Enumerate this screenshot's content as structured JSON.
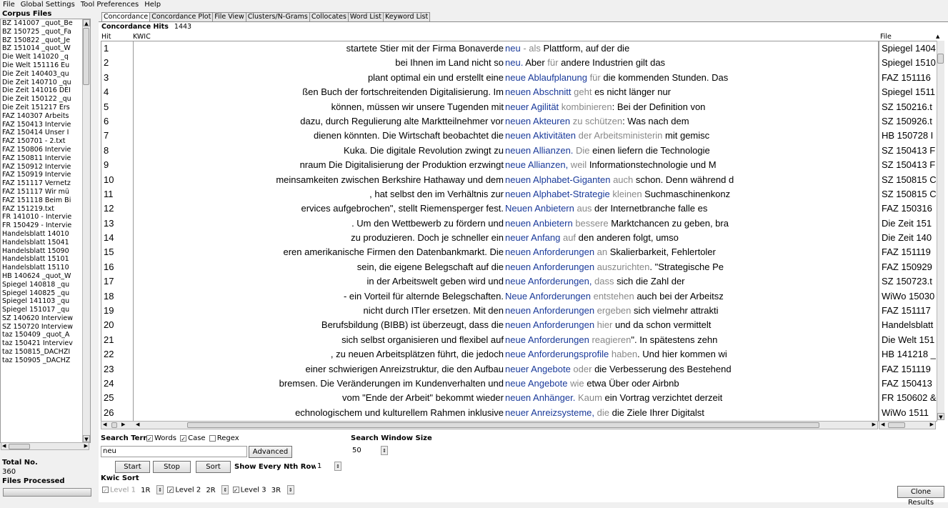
{
  "menu": [
    "File",
    "Global Settings",
    "Tool Preferences",
    "Help"
  ],
  "left_panel": {
    "corpus_files_label": "Corpus Files",
    "files": [
      "BZ 141007 _quot_Be",
      "BZ 150725 _quot_Fa",
      "BZ 150822 _quot_Je",
      "BZ 151014 _quot_W",
      "Die Welt 141020 _q",
      "Die Welt 151116 Eu",
      "Die Zeit 140403_qu",
      "Die Zeit 140710 _qu",
      "Die Zeit 141016 DEI",
      "Die Zeit 150122 _qu",
      "Die Zeit 151217 Ers",
      "FAZ 140307 Arbeits",
      "FAZ 150413 Intervie",
      "FAZ 150414 Unser I",
      "FAZ 150701 - 2.txt",
      "FAZ 150806 Intervie",
      "FAZ 150811 Intervie",
      "FAZ 150912 Intervie",
      "FAZ 150919 Intervie",
      "FAZ 151117 Vernetz",
      "FAZ 151117 Wir mü",
      "FAZ 151118 Beim Bi",
      "FAZ 151219.txt",
      "FR 141010 - Intervie",
      "FR 150429 - Intervie",
      "Handelsblatt 14010",
      "Handelsblatt 15041",
      "Handelsblatt 15090",
      "Handelsblatt 15101",
      "Handelsblatt 15110",
      "HB 140624 _quot_W",
      "Spiegel 140818 _qu",
      "Spiegel 140825 _qu",
      "Spiegel 141103 _qu",
      "Spiegel 151017 _qu",
      "SZ 140620 Interview",
      "SZ 150720 Interview",
      "taz 150409 _quot_A",
      "taz 150421 Interviev",
      "taz 150815_DACHZI",
      "taz 150905 _DACHZ"
    ],
    "total_no_label": "Total No.",
    "total_no_value": "360",
    "files_processed_label": "Files Processed"
  },
  "tabs": [
    "Concordance",
    "Concordance Plot",
    "File View",
    "Clusters/N-Grams",
    "Collocates",
    "Word List",
    "Keyword List"
  ],
  "concordance": {
    "hits_label": "Concordance Hits",
    "hits_value": "1443",
    "col_hit": "Hit",
    "col_kwic": "KWIC",
    "col_file": "File",
    "rows": [
      {
        "hit": "1",
        "left": "startete Stier mit der Firma Bonaverde",
        "kw": "neu",
        "r": [
          [
            "w1",
            " - als "
          ],
          [
            "w2",
            "Plattform, auf der die"
          ]
        ],
        "file": "Spiegel 1404"
      },
      {
        "hit": "2",
        "left": "bei Ihnen im Land nicht so",
        "kw": "neu.",
        "r": [
          [
            "w2",
            " Aber "
          ],
          [
            "w1",
            "für "
          ],
          [
            "w2",
            "andere Industrien gilt das"
          ]
        ],
        "file": "Spiegel 1510"
      },
      {
        "hit": "3",
        "left": "plant optimal ein und erstellt eine",
        "kw": "neue Ablaufplanung",
        "r": [
          [
            "w1",
            " für "
          ],
          [
            "w2",
            "die kommenden Stunden. Das"
          ]
        ],
        "file": "FAZ 151116"
      },
      {
        "hit": "4",
        "left": "ßen Buch der fortschreitenden Digitalisierung. Im",
        "kw": "neuen Abschnitt",
        "r": [
          [
            "w1",
            " geht "
          ],
          [
            "w2",
            "es nicht länger nur"
          ]
        ],
        "file": "Spiegel 1511"
      },
      {
        "hit": "5",
        "left": "können, müssen wir unsere Tugenden mit",
        "kw": "neuer Agilität",
        "r": [
          [
            "w1",
            " kombinieren"
          ],
          [
            "w2",
            ": Bei der Definition von"
          ]
        ],
        "file": "SZ 150216.t"
      },
      {
        "hit": "6",
        "left": "dazu, durch Regulierung alte Marktteilnehmer vor",
        "kw": "neuen Akteuren",
        "r": [
          [
            "w1",
            " zu schützen"
          ],
          [
            "w2",
            ": Was nach dem"
          ]
        ],
        "file": "SZ 150926.t"
      },
      {
        "hit": "7",
        "left": "dienen könnten. Die Wirtschaft beobachtet die",
        "kw": "neuen Aktivitäten",
        "r": [
          [
            "w1",
            " der Arbeitsministerin "
          ],
          [
            "w2",
            "mit gemisc"
          ]
        ],
        "file": "HB 150728 I"
      },
      {
        "hit": "8",
        "left": "Kuka. Die digitale Revolution zwingt zu",
        "kw": "neuen Allianzen.",
        "r": [
          [
            "w1",
            " Die "
          ],
          [
            "w2",
            "einen liefern die Technologie"
          ]
        ],
        "file": "SZ 150413 F"
      },
      {
        "hit": "9",
        "left": "nraum Die Digitalisierung der Produktion erzwingt",
        "kw": "neue Allianzen,",
        "r": [
          [
            "w1",
            " weil "
          ],
          [
            "w2",
            "Informationstechnologie und M"
          ]
        ],
        "file": "SZ 150413 F"
      },
      {
        "hit": "10",
        "left": "meinsamkeiten zwischen Berkshire Hathaway und dem",
        "kw": "neuen Alphabet-Giganten",
        "r": [
          [
            "w1",
            " auch "
          ],
          [
            "w2",
            "schon. Denn während d"
          ]
        ],
        "file": "SZ 150815 C"
      },
      {
        "hit": "11",
        "left": ", hat selbst den im Verhältnis zur",
        "kw": "neuen Alphabet-Strategie",
        "r": [
          [
            "w1",
            " kleinen "
          ],
          [
            "w2",
            "Suchmaschinenkonz"
          ]
        ],
        "file": "SZ 150815 C"
      },
      {
        "hit": "12",
        "left": "ervices aufgebrochen\", stellt Riemensperger fest.",
        "kw": "Neuen Anbietern",
        "r": [
          [
            "w1",
            " aus "
          ],
          [
            "w2",
            "der Internetbranche falle es"
          ]
        ],
        "file": "FAZ 150316"
      },
      {
        "hit": "13",
        "left": ". Um den Wettbewerb zu fördern und",
        "kw": "neuen Anbietern",
        "r": [
          [
            "w1",
            " bessere "
          ],
          [
            "w2",
            "Marktchancen zu geben, bra"
          ]
        ],
        "file": "Die Zeit 151"
      },
      {
        "hit": "14",
        "left": "zu produzieren. Doch je schneller ein",
        "kw": "neuer Anfang",
        "r": [
          [
            "w1",
            " auf "
          ],
          [
            "w2",
            "den anderen folgt, umso"
          ]
        ],
        "file": "Die Zeit 140"
      },
      {
        "hit": "15",
        "left": "eren amerikanische Firmen den Datenbankmarkt. Die",
        "kw": "neuen Anforderungen",
        "r": [
          [
            "w1",
            " an "
          ],
          [
            "w2",
            "Skalierbarkeit, Fehlertoler"
          ]
        ],
        "file": "FAZ 151119"
      },
      {
        "hit": "16",
        "left": "sein, die eigene Belegschaft auf die",
        "kw": "neuen Anforderungen",
        "r": [
          [
            "w1",
            " auszurichten"
          ],
          [
            "w2",
            ". \"Strategische Pe"
          ]
        ],
        "file": "FAZ 150929"
      },
      {
        "hit": "17",
        "left": "in der Arbeitswelt geben wird und",
        "kw": "neue Anforderungen,",
        "r": [
          [
            "w1",
            " dass "
          ],
          [
            "w2",
            "sich die Zahl der"
          ]
        ],
        "file": "SZ 150723.t"
      },
      {
        "hit": "18",
        "left": "- ein Vorteil für alternde Belegschaften.",
        "kw": "Neue Anforderungen",
        "r": [
          [
            "w1",
            " entstehen "
          ],
          [
            "w2",
            "auch bei der Arbeitsz"
          ]
        ],
        "file": "WiWo 15030"
      },
      {
        "hit": "19",
        "left": "nicht durch ITler ersetzen. Mit den",
        "kw": "neuen Anforderungen",
        "r": [
          [
            "w1",
            " ergeben "
          ],
          [
            "w2",
            "sich vielmehr attrakti"
          ]
        ],
        "file": "FAZ 151117"
      },
      {
        "hit": "20",
        "left": "Berufsbildung (BIBB) ist überzeugt, dass die",
        "kw": "neuen Anforderungen",
        "r": [
          [
            "w1",
            " hier "
          ],
          [
            "w2",
            "und da schon vermittelt"
          ]
        ],
        "file": "Handelsblatt"
      },
      {
        "hit": "21",
        "left": "sich selbst organisieren und flexibel auf",
        "kw": "neue Anforderungen",
        "r": [
          [
            "w1",
            " reagieren"
          ],
          [
            "w2",
            "\".  In spätestens zehn"
          ]
        ],
        "file": "Die Welt 151"
      },
      {
        "hit": "22",
        "left": ", zu neuen Arbeitsplätzen führt, die jedoch",
        "kw": "neue Anforderungsprofile",
        "r": [
          [
            "w1",
            " haben"
          ],
          [
            "w2",
            ". Und hier kommen wi"
          ]
        ],
        "file": "HB 141218 _"
      },
      {
        "hit": "23",
        "left": "einer schwierigen Anreizstruktur, die den Aufbau",
        "kw": "neuer Angebote",
        "r": [
          [
            "w1",
            " oder "
          ],
          [
            "w2",
            "die Verbesserung des Bestehend"
          ]
        ],
        "file": "FAZ 151119"
      },
      {
        "hit": "24",
        "left": "bremsen. Die Veränderungen im Kundenverhalten und",
        "kw": "neue Angebote",
        "r": [
          [
            "w1",
            " wie "
          ],
          [
            "w2",
            "etwa Über oder Airbnb"
          ]
        ],
        "file": "FAZ 150413"
      },
      {
        "hit": "25",
        "left": "vom \"Ende der Arbeit\" bekommt wieder",
        "kw": "neuen Anhänger.",
        "r": [
          [
            "w1",
            " Kaum "
          ],
          [
            "w2",
            "ein Vortrag verzichtet derzeit"
          ]
        ],
        "file": "FR 150602 &"
      },
      {
        "hit": "26",
        "left": "echnologischem und kulturellem Rahmen  inklusive",
        "kw": "neuer Anreizsysteme,",
        "r": [
          [
            "w1",
            " die "
          ],
          [
            "w2",
            "die Ziele Ihrer Digitalst"
          ]
        ],
        "file": "WiWo 1511"
      }
    ]
  },
  "controls": {
    "search_term_label": "Search Term",
    "words_label": "Words",
    "case_label": "Case",
    "regex_label": "Regex",
    "search_value": "neu",
    "advanced_label": "Advanced",
    "search_window_label": "Search Window Size",
    "search_window_value": "50",
    "start_label": "Start",
    "stop_label": "Stop",
    "sort_label": "Sort",
    "nth_row_label": "Show Every Nth Row",
    "nth_row_value": "1",
    "kwic_sort_label": "Kwic Sort",
    "level1_label": "Level 1",
    "level1_value": "1R",
    "level2_label": "Level 2",
    "level2_value": "2R",
    "level3_label": "Level 3",
    "level3_value": "3R",
    "clone_label": "Clone Results"
  },
  "colors": {
    "keyword": "#1a3a9a",
    "collocate_gray": "#888888"
  }
}
